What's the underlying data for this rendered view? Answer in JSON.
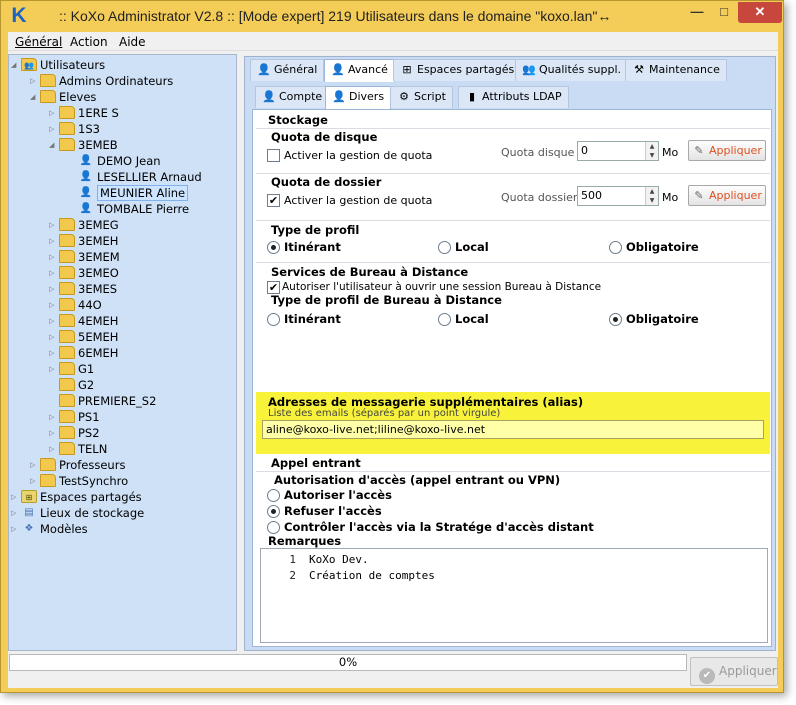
{
  "window": {
    "title": ":: KoXo Administrator V2.8 :: [Mode expert] 219 Utilisateurs dans le domaine \"koxo.lan\"",
    "resize_glyph": "↔",
    "logo": "K",
    "controls": {
      "minimize": "—",
      "maximize": "□",
      "close": "✕"
    },
    "accent": "#f4cc58"
  },
  "menu": [
    "Général",
    "Action",
    "Aide"
  ],
  "tree": [
    {
      "label": "Utilisateurs",
      "icon": "users-folder-icon",
      "expander": "◢"
    },
    {
      "label": "Admins Ordinateurs",
      "icon": "folder-icon",
      "expander": "▷"
    },
    {
      "label": "Eleves",
      "icon": "folder-icon",
      "expander": "◢"
    },
    {
      "label": "1ERE S",
      "icon": "folder-icon",
      "expander": "▷"
    },
    {
      "label": "1S3",
      "icon": "folder-icon",
      "expander": "▷"
    },
    {
      "label": "3EMEB",
      "icon": "folder-icon",
      "expander": "◢"
    },
    {
      "label": "DEMO Jean",
      "icon": "user-icon"
    },
    {
      "label": "LESELLIER Arnaud",
      "icon": "user-icon"
    },
    {
      "label": "MEUNIER Aline",
      "icon": "user-icon",
      "selected": true
    },
    {
      "label": "TOMBALE Pierre",
      "icon": "user-icon"
    },
    {
      "label": "3EMEG",
      "icon": "folder-icon",
      "expander": "▷"
    },
    {
      "label": "3EMEH",
      "icon": "folder-icon",
      "expander": "▷"
    },
    {
      "label": "3EMEM",
      "icon": "folder-icon",
      "expander": "▷"
    },
    {
      "label": "3EMEO",
      "icon": "folder-icon",
      "expander": "▷"
    },
    {
      "label": "3EMES",
      "icon": "folder-icon",
      "expander": "▷"
    },
    {
      "label": "44O",
      "icon": "folder-icon",
      "expander": "▷"
    },
    {
      "label": "4EMEH",
      "icon": "folder-icon",
      "expander": "▷"
    },
    {
      "label": "5EMEH",
      "icon": "folder-icon",
      "expander": "▷"
    },
    {
      "label": "6EMEH",
      "icon": "folder-icon",
      "expander": "▷"
    },
    {
      "label": "G1",
      "icon": "folder-icon",
      "expander": "▷"
    },
    {
      "label": "G2",
      "icon": "folder-icon"
    },
    {
      "label": "PREMIERE_S2",
      "icon": "folder-icon"
    },
    {
      "label": "PS1",
      "icon": "folder-icon",
      "expander": "▷"
    },
    {
      "label": "PS2",
      "icon": "folder-icon",
      "expander": "▷"
    },
    {
      "label": "TELN",
      "icon": "folder-icon",
      "expander": "▷"
    },
    {
      "label": "Professeurs",
      "icon": "folder-icon",
      "expander": "▷"
    },
    {
      "label": "TestSynchro",
      "icon": "folder-icon",
      "expander": "▷"
    },
    {
      "label": "Espaces partagés",
      "icon": "shared-space-icon",
      "expander": "▷"
    },
    {
      "label": "Lieux de stockage",
      "icon": "storage-icon",
      "expander": "▷"
    },
    {
      "label": "Modèles",
      "icon": "templates-icon",
      "expander": "▷"
    }
  ],
  "tabs_main": [
    {
      "label": "Général",
      "icon": "user-icon"
    },
    {
      "label": "Avancé",
      "icon": "user-advanced-icon",
      "active": true
    },
    {
      "label": "Espaces partagés",
      "icon": "shared-space-icon"
    },
    {
      "label": "Qualités suppl.",
      "icon": "people-icon"
    },
    {
      "label": "Maintenance",
      "icon": "tools-icon"
    }
  ],
  "tabs_sub": [
    {
      "label": "Compte",
      "icon": "user-icon"
    },
    {
      "label": "Divers",
      "icon": "user-misc-icon",
      "active": true
    },
    {
      "label": "Script",
      "icon": "script-gear-icon"
    },
    {
      "label": "Attributs LDAP",
      "icon": "book-icon"
    }
  ],
  "stockage": {
    "heading": "Stockage",
    "quota_disque": {
      "heading": "Quota de disque",
      "checkbox_label": "Activer la gestion de quota",
      "checked": false,
      "field_label": "Quota disque",
      "value": "0",
      "unit": "Mo",
      "apply_label": "Appliquer"
    },
    "quota_dossier": {
      "heading": "Quota de dossier",
      "checkbox_label": "Activer la gestion de quota",
      "checked": true,
      "field_label": "Quota dossier",
      "value": "500",
      "unit": "Mo",
      "apply_label": "Appliquer"
    }
  },
  "profil": {
    "heading": "Type de profil",
    "options": [
      "Itinérant",
      "Local",
      "Obligatoire"
    ],
    "selected": "Itinérant"
  },
  "rds": {
    "heading": "Services de Bureau à Distance",
    "checkbox_label": "Autoriser l'utilisateur à ouvrir une session Bureau à Distance",
    "checked": true,
    "profile_heading": "Type de profil de Bureau à Distance",
    "options": [
      "Itinérant",
      "Local",
      "Obligatoire"
    ],
    "selected": "Obligatoire"
  },
  "alias": {
    "heading": "Adresses de messagerie supplémentaires (alias)",
    "hint": "Liste des emails (séparés par un point virgule)",
    "value": "aline@koxo-live.net;liline@koxo-live.net",
    "highlight": "#f8f33a"
  },
  "appel": {
    "heading": "Appel entrant",
    "subheading": "Autorisation d'accès (appel entrant ou VPN)",
    "options": [
      "Autoriser l'accès",
      "Refuser l'accès",
      "Contrôler l'accès via la Stratége d'accès distant"
    ],
    "selected": "Refuser l'accès"
  },
  "remarques": {
    "heading": "Remarques",
    "lines": [
      {
        "n": "1",
        "text": "KoXo Dev."
      },
      {
        "n": "2",
        "text": "Création de comptes"
      }
    ]
  },
  "status": {
    "progress_text": "0%",
    "progress": 0,
    "apply_label": "Appliquer",
    "apply_enabled": false
  }
}
